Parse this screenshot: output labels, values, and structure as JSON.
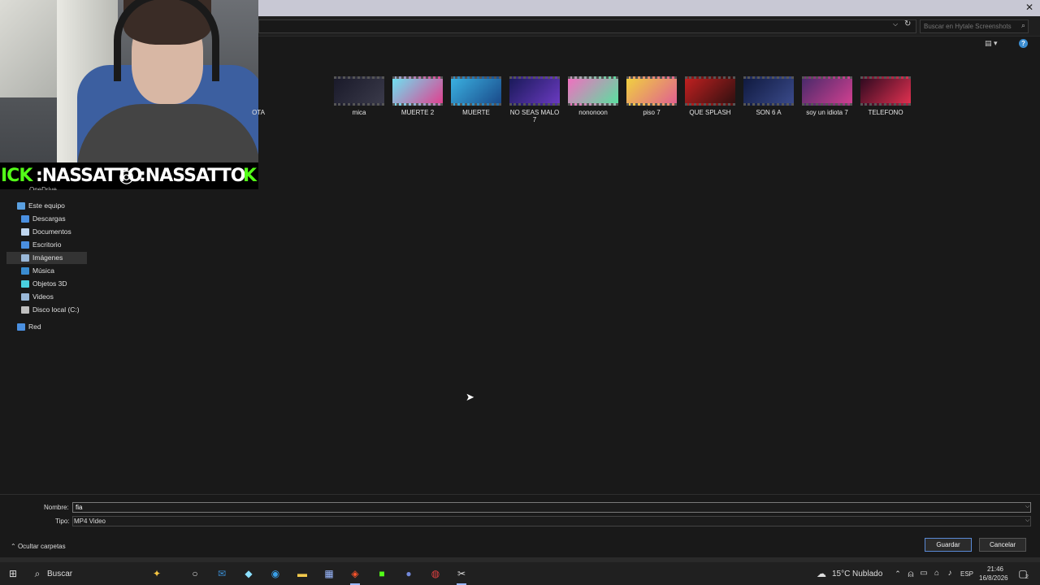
{
  "search": {
    "placeholder": "Buscar en Hytale Screenshots"
  },
  "overlay": {
    "kick_handle_prefix": "ICK",
    "handle_1": ":NASSATTO",
    "handle_2": ":NASSATTO",
    "kick_suffix": "K",
    "kick_color": "#53fc18"
  },
  "sidebar": {
    "cutoff": "OneDrive",
    "items": [
      {
        "label": "Este equipo",
        "icon": "pc-icon",
        "selected": false
      },
      {
        "label": "Descargas",
        "icon": "download-icon",
        "selected": false
      },
      {
        "label": "Documentos",
        "icon": "document-icon",
        "selected": false
      },
      {
        "label": "Escritorio",
        "icon": "desktop-icon",
        "selected": false
      },
      {
        "label": "Imágenes",
        "icon": "images-icon",
        "selected": true
      },
      {
        "label": "Música",
        "icon": "music-icon",
        "selected": false
      },
      {
        "label": "Objetos 3D",
        "icon": "cube-icon",
        "selected": false
      },
      {
        "label": "Videos",
        "icon": "video-icon",
        "selected": false
      },
      {
        "label": "Disco local (C:)",
        "icon": "drive-icon",
        "selected": false
      },
      {
        "label": "Red",
        "icon": "network-icon",
        "selected": false
      }
    ]
  },
  "files": [
    {
      "label": "OTA"
    },
    {
      "label": "mica"
    },
    {
      "label": "MUERTE 2"
    },
    {
      "label": "MUERTE"
    },
    {
      "label": "NO SEAS MALO 7"
    },
    {
      "label": "nononoon"
    },
    {
      "label": "piso 7"
    },
    {
      "label": "QUE SPLASH"
    },
    {
      "label": "SON 6 A"
    },
    {
      "label": "soy un idiota 7"
    },
    {
      "label": "TELEFONO"
    }
  ],
  "form": {
    "name_label": "Nombre:",
    "name_value": "fia",
    "type_label": "Tipo:",
    "type_value": "MP4 Video",
    "hide_folders": "Ocultar carpetas",
    "save": "Guardar",
    "cancel": "Cancelar"
  },
  "taskbar": {
    "search_text": "Buscar",
    "weather_temp": "15°C",
    "weather_desc": "Nublado",
    "language": "ESP",
    "time": "21:46",
    "date": "16/8/2026",
    "notifications": "2"
  },
  "colors": {
    "accent": "#3a8cd0",
    "background": "#191919"
  }
}
